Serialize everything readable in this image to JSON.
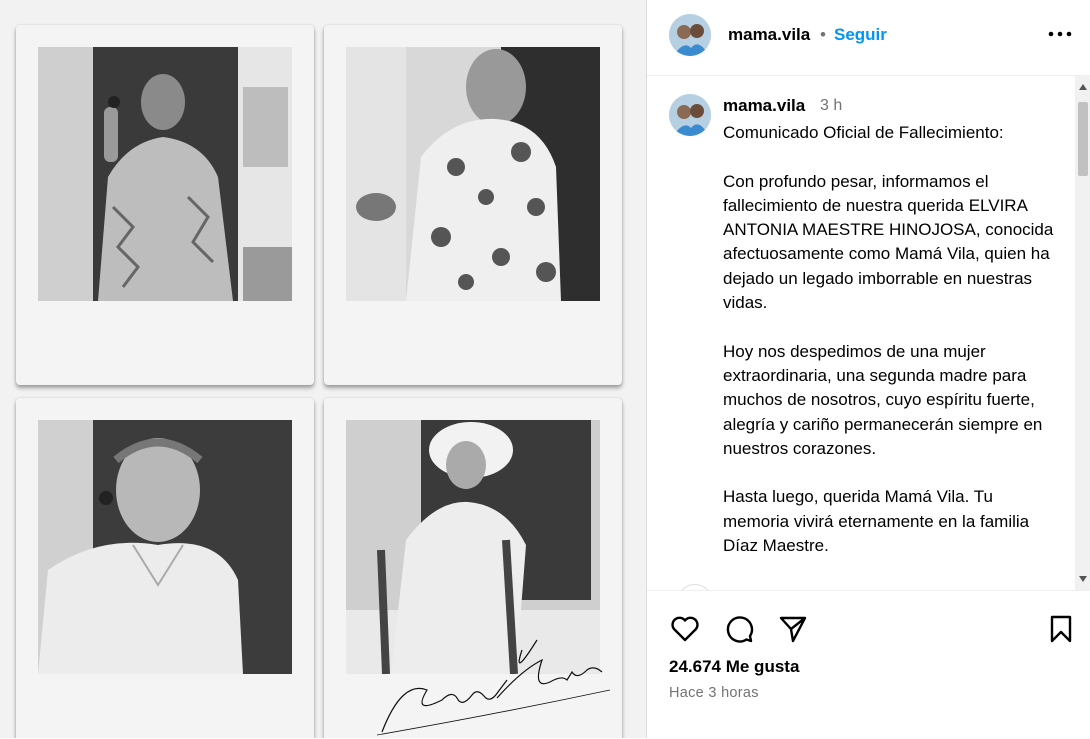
{
  "media": {
    "photos": [
      {
        "description": "elderly-woman-waving-photo"
      },
      {
        "description": "elderly-woman-laughing-photo"
      },
      {
        "description": "elderly-woman-smiling-portrait"
      },
      {
        "description": "elderly-woman-in-sun-hat-photo"
      }
    ],
    "signature_text": "Mamá Vila"
  },
  "header": {
    "username": "mama.vila",
    "separator": "•",
    "follow_label": "Seguir",
    "more_icon": "more-horizontal-icon"
  },
  "post": {
    "username": "mama.vila",
    "time": "3 h",
    "caption": "Comunicado Oficial de Fallecimiento:\n\nCon profundo pesar, informamos el fallecimiento de nuestra querida ELVIRA ANTONIA MAESTRE HINOJOSA, conocida afectuosamente como Mamá Vila, quien ha dejado un legado imborrable en nuestras vidas.\n\nHoy nos despedimos de una mujer extraordinaria, una segunda madre para muchos de nosotros, cuyo espíritu fuerte, alegría y cariño permanecerán siempre en nuestros corazones.\n\nHasta luego, querida Mamá Vila. Tu memoria vivirá eternamente en la familia Díaz Maestre."
  },
  "actions": {
    "icons": [
      "heart-icon",
      "comment-icon",
      "share-icon",
      "bookmark-icon"
    ],
    "likes": "24.674 Me gusta",
    "posted_ago": "Hace 3 horas"
  },
  "colors": {
    "accent": "#0095f6",
    "secondary_text": "#737373",
    "border": "#dbdbdb"
  }
}
